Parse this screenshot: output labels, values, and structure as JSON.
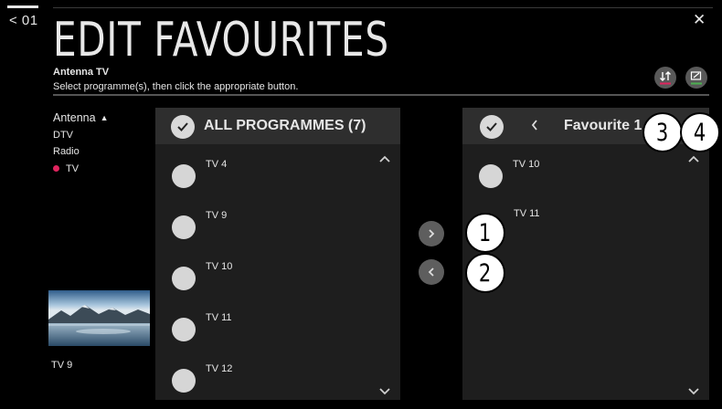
{
  "nav": {
    "back_label": "< 01"
  },
  "header": {
    "title": "EDIT FAVOURITES",
    "source": "Antenna TV",
    "instructions": "Select programme(s), then click the appropriate button."
  },
  "sidebar": {
    "header": "Antenna",
    "items": [
      {
        "label": "DTV",
        "selected": false
      },
      {
        "label": "Radio",
        "selected": false
      },
      {
        "label": "TV",
        "selected": true
      }
    ],
    "selected_color": "#e0245e"
  },
  "preview": {
    "label": "TV 9"
  },
  "left_panel": {
    "title": "ALL PROGRAMMES (7)",
    "programmes": [
      "TV 4",
      "TV 9",
      "TV 10",
      "TV 11",
      "TV 12"
    ]
  },
  "right_panel": {
    "title": "Favourite 1",
    "programmes": [
      {
        "label": "TV 10",
        "has_radio": true
      },
      {
        "label": "TV 11",
        "has_radio": false
      }
    ]
  },
  "callouts": [
    "1",
    "2",
    "3",
    "4"
  ],
  "colors": {
    "background": "#000000",
    "panel": "#1e1e1e",
    "panel_header": "#2e2e2e",
    "reorder_accent": "#e0245e",
    "edit_accent": "#4caf50"
  }
}
